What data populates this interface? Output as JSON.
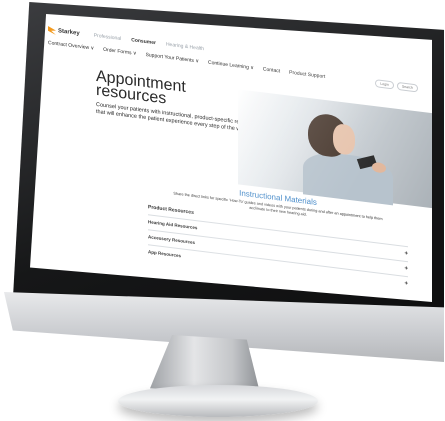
{
  "site": {
    "brand": "Starkey",
    "audiences": [
      "Professional",
      "Consumer",
      "Hearing & Health"
    ],
    "active_audience_index": 1
  },
  "nav": {
    "items": [
      "Contract Overview ∨",
      "Order Forms ∨",
      "Support Your Patients ∨",
      "Continue Learning ∨",
      "Contact",
      "Product Support"
    ],
    "login": "Login",
    "search": "Search"
  },
  "hero": {
    "title": "Appointment resources",
    "subtitle": "Counsel your patients with instructional, product-specific resources that will enhance the patient experience every step of the way."
  },
  "materials": {
    "title": "Instructional Materials",
    "description": "Share the direct links for specific 'How-To' guides and videos with your patients during and after an appointment to help them acclimate to their new hearing aid.",
    "group_heading": "Product Resources",
    "rows": [
      {
        "label": "Hearing Aid Resources",
        "icon": "+"
      },
      {
        "label": "Accessory Resources",
        "icon": "+"
      },
      {
        "label": "App Resources",
        "icon": "+"
      }
    ]
  }
}
